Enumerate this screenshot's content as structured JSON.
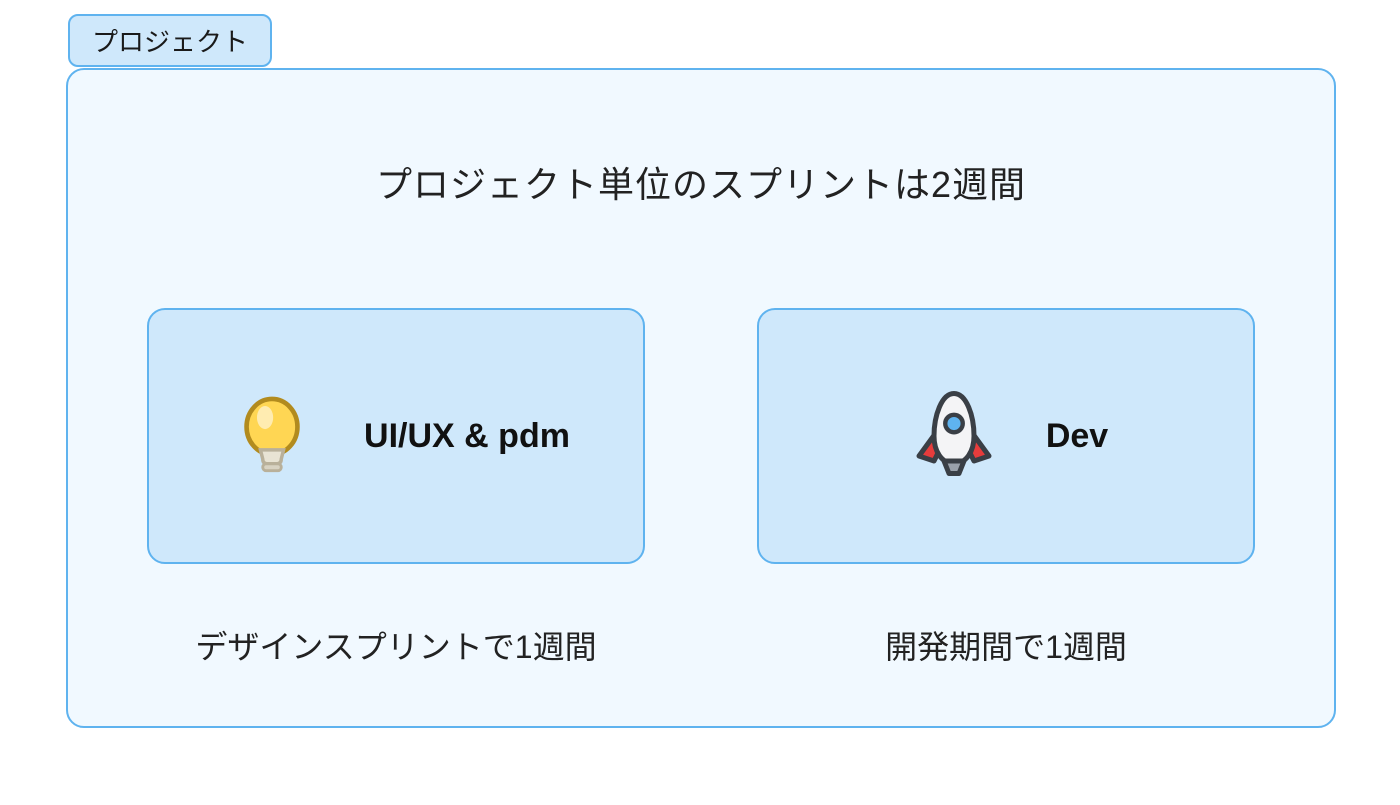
{
  "tab": {
    "label": "プロジェクト"
  },
  "headline": "プロジェクト単位のスプリントは2週間",
  "cards": [
    {
      "icon": "bulb-icon",
      "label": "UI/UX & pdm",
      "sub": "デザインスプリントで1週間"
    },
    {
      "icon": "rocket-icon",
      "label": "Dev",
      "sub": "開発期間で1週間"
    }
  ],
  "colors": {
    "panel_bg": "#f1f9ff",
    "card_bg": "#cfe8fb",
    "border": "#5fb3ef"
  }
}
